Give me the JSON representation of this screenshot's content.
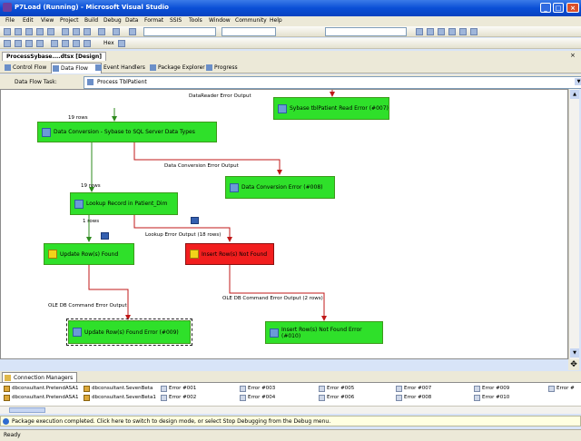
{
  "window": {
    "title": "P7Load (Running) - Microsoft Visual Studio",
    "min_label": "_",
    "max_label": "□",
    "close_label": "×"
  },
  "menu": [
    "File",
    "Edit",
    "View",
    "Project",
    "Build",
    "Debug",
    "Data",
    "Format",
    "SSIS",
    "Tools",
    "Window",
    "Community",
    "Help"
  ],
  "toolbar2": {
    "hex_label": "Hex"
  },
  "document": {
    "tab_label": "ProcessSybase....dtsx [Design]"
  },
  "designer_tabs": [
    "Control Flow",
    "Data Flow",
    "Event Handlers",
    "Package Explorer",
    "Progress"
  ],
  "active_designer_tab": "Data Flow",
  "task": {
    "label": "Data Flow Task:",
    "selected": "Process TblPatient"
  },
  "flow": {
    "boxes": {
      "read_error": "Sybase tblPatient Read Error (#007)",
      "data_conversion": "Data Conversion - Sybase to SQL Server Data Types",
      "conversion_error": "Data Conversion Error (#008)",
      "lookup": "Lookup Record in Patient_Dim",
      "update_found": "Update Row(s) Found",
      "insert_not_found": "Insert Row(s) Not Found",
      "update_found_error": "Update Row(s) Found Error (#009)",
      "insert_not_found_error": "Insert Row(s) Not Found Error (#010)"
    },
    "labels": {
      "datareader_error_output": "DataReader Error Output",
      "rows_19_a": "19 rows",
      "conversion_error_output": "Data Conversion Error Output",
      "rows_19_b": "19 rows",
      "rows_1": "1 rows",
      "lookup_error_output": "Lookup Error Output (18 rows)",
      "oledb_error_left": "OLE DB Command Error Output",
      "oledb_error_right": "OLE DB Command Error Output (2 rows)"
    }
  },
  "connection_managers": {
    "tab_label": "Connection Managers",
    "items": [
      "dbconsultant.PretendASA1",
      "dbconsultant.SevenBeta",
      "Error #001",
      "Error #003",
      "Error #005",
      "Error #007",
      "Error #009",
      "Error #",
      "dbconsultant.PretendASA1",
      "dbconsultant.SevenBeta1",
      "Error #002",
      "Error #004",
      "Error #006",
      "Error #008",
      "Error #010"
    ]
  },
  "notification": "Package execution completed. Click here to switch to design mode, or select Stop Debugging from the Debug menu.",
  "status": "Ready",
  "colors": {
    "success_box": "#2fe02a",
    "error_box": "#f21e1e",
    "success_path": "#2e8b1e",
    "error_path": "#c01818"
  }
}
